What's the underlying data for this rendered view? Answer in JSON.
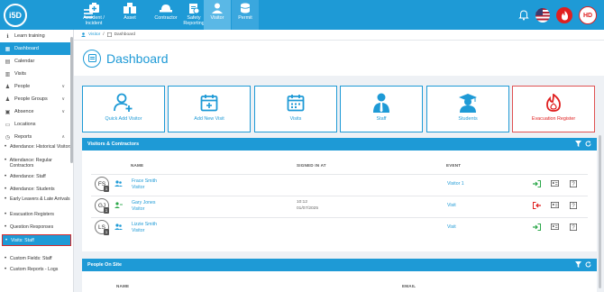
{
  "header": {
    "logo": "i5D",
    "nav": [
      {
        "label": "Accident / Incident",
        "icon": "accident-icon",
        "active": false
      },
      {
        "label": "Asset",
        "icon": "asset-icon",
        "active": false
      },
      {
        "label": "Contractor",
        "icon": "contractor-icon",
        "active": false
      },
      {
        "label": "Safety Reporting",
        "icon": "safety-reporting-icon",
        "active": false
      },
      {
        "label": "Visitor",
        "icon": "visitor-icon",
        "active": true
      },
      {
        "label": "Permit",
        "icon": "permit-icon",
        "active": false
      }
    ],
    "avatar": "HD",
    "colors": {
      "brand": "#1e9ad6",
      "alert": "#e02020"
    }
  },
  "sidebar": {
    "items": [
      {
        "label": "Learn training",
        "icon": "graduation-icon"
      },
      {
        "label": "Dashboard",
        "icon": "dashboard-icon",
        "active": true
      },
      {
        "label": "Calendar",
        "icon": "calendar-icon"
      },
      {
        "label": "Visits",
        "icon": "visits-icon"
      },
      {
        "label": "People",
        "icon": "people-icon",
        "has_children": true
      },
      {
        "label": "People Groups",
        "icon": "people-groups-icon",
        "has_children": true
      },
      {
        "label": "Absence",
        "icon": "absence-icon",
        "has_children": true
      },
      {
        "label": "Locations",
        "icon": "locations-icon"
      },
      {
        "label": "Reports",
        "icon": "reports-icon",
        "has_children": true,
        "expanded": true
      }
    ],
    "report_items": [
      "Attendance: Historical Visitors",
      "Attendance: Regular Contractors",
      "Attendance: Staff",
      "Attendance: Students",
      "Early Leavers & Late Arrivals",
      "Evacuation Registers",
      "Question Responses",
      "Visits: Staff",
      "Custom Fields: Staff",
      "Custom Reports - Logs"
    ]
  },
  "breadcrumb": {
    "link": "Visitor",
    "separator": "/",
    "current": "Dashboard"
  },
  "page": {
    "title": "Dashboard"
  },
  "tiles": [
    {
      "label": "Quick Add Visitor",
      "icon": "add-user-icon"
    },
    {
      "label": "Add New Visit",
      "icon": "calendar-plus-icon"
    },
    {
      "label": "Visits",
      "icon": "calendar-grid-icon"
    },
    {
      "label": "Staff",
      "icon": "staff-icon"
    },
    {
      "label": "Students",
      "icon": "student-icon"
    },
    {
      "label": "Evacuation Register",
      "icon": "fire-icon"
    }
  ],
  "visitors_panel": {
    "title": "Visitors & Contractors",
    "columns": {
      "name": "NAME",
      "signed_in": "SIGNED IN AT",
      "event": "EVENT"
    },
    "rows": [
      {
        "initials": "FS",
        "badge": "1",
        "name": "Frace Smith",
        "type": "Visitor",
        "signed_date": "",
        "signed_time": "",
        "event": "Visitor 1",
        "action": "sign-in"
      },
      {
        "initials": "GJ",
        "badge": "1",
        "name": "Gary Jones",
        "type": "Visitor",
        "signed_date": "10:12",
        "signed_time": "01/07/2025",
        "event": "Visit",
        "action": "sign-out"
      },
      {
        "initials": "LS",
        "badge": "1",
        "name": "Lizzie Smith",
        "type": "Visitor",
        "signed_date": "",
        "signed_time": "",
        "event": "Visit",
        "action": "sign-in"
      }
    ]
  },
  "people_panel": {
    "title": "People On Site",
    "columns": {
      "name": "NAME",
      "email": "EMAIL"
    }
  }
}
